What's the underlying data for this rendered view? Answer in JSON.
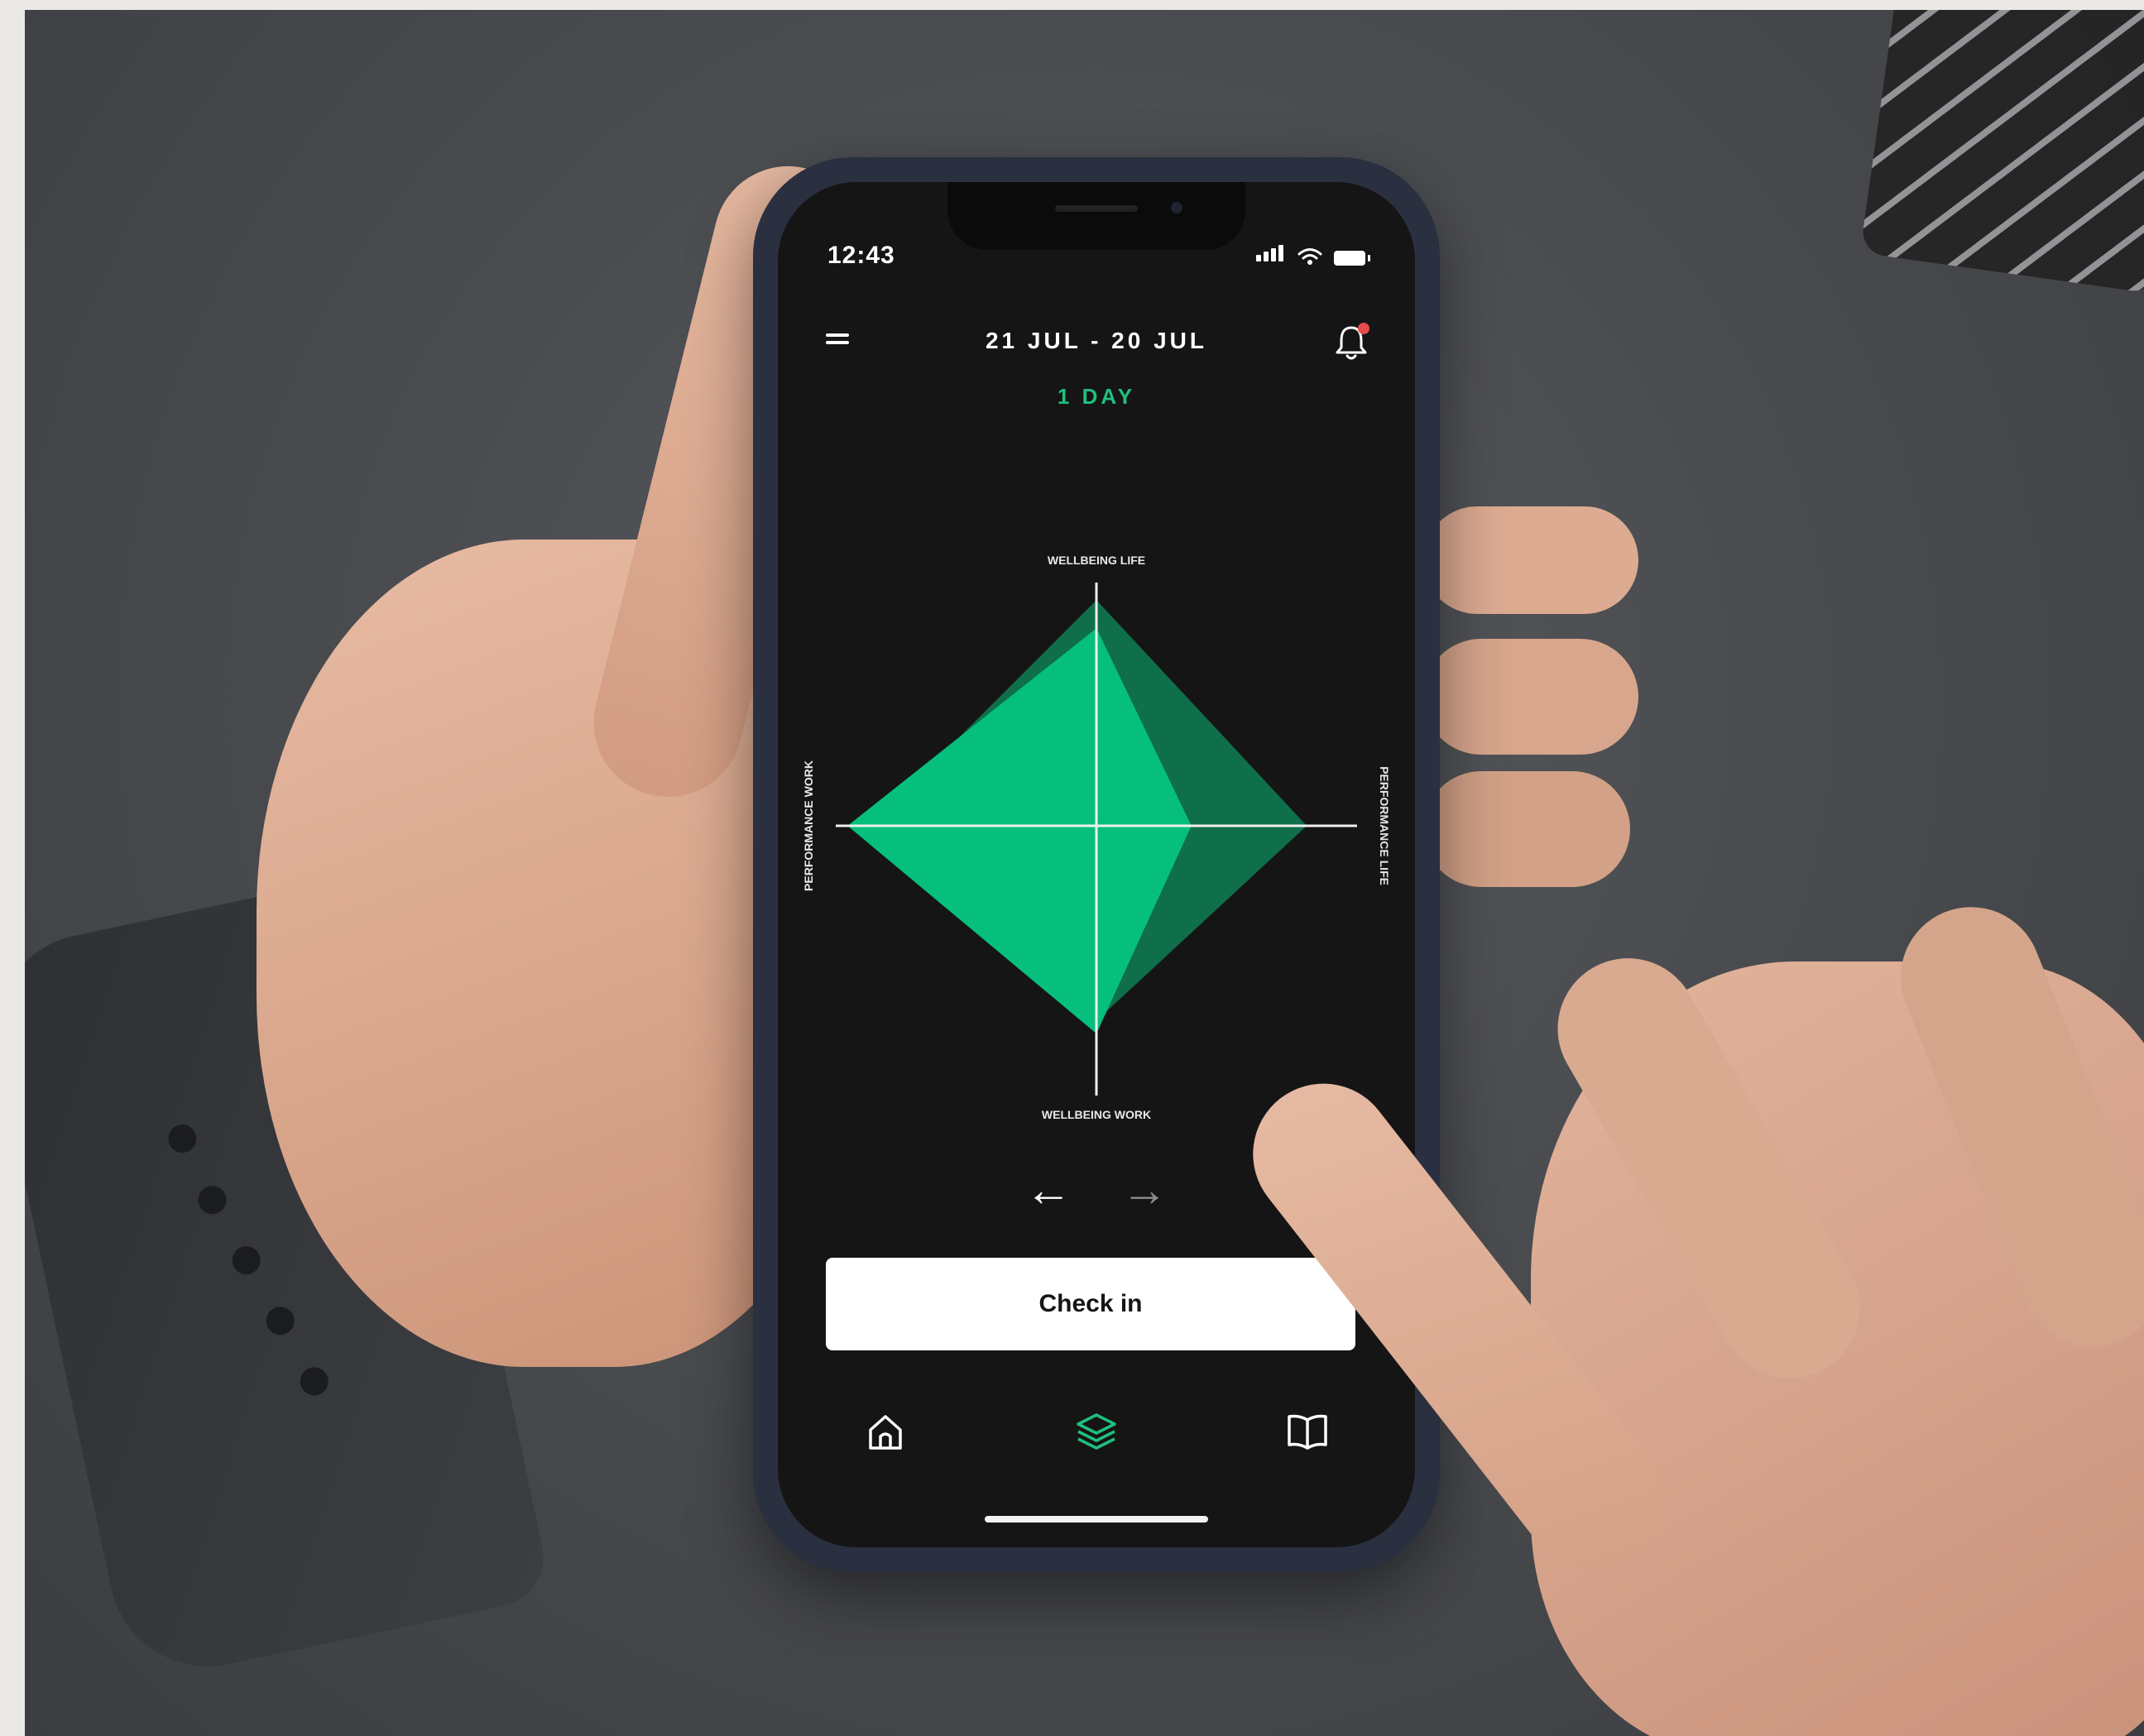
{
  "status_bar": {
    "time": "12:43"
  },
  "header": {
    "date_range": "21 JUL - 20 JUL",
    "period": "1 DAY",
    "accent_color": "#1fc07e",
    "notification_dot_color": "#e64b4b"
  },
  "chart_data": {
    "type": "radar",
    "axes": [
      "WELLBEING LIFE",
      "PERFORMANCE LIFE",
      "WELLBEING WORK",
      "PERFORMANCE WORK"
    ],
    "series": [
      {
        "values": [
          0.88,
          0.82,
          0.76,
          0.88
        ],
        "color": "#0f6f4a"
      },
      {
        "values": [
          0.77,
          0.37,
          0.81,
          0.64
        ],
        "color": "#16ad73"
      },
      {
        "values": [
          0.77,
          0.37,
          0.81,
          0.97
        ],
        "color": "#06bf7d"
      }
    ]
  },
  "navigation": {
    "prev_icon": "arrow-left-icon",
    "next_icon": "arrow-right-icon"
  },
  "actions": {
    "checkin_label": "Check in"
  },
  "tabbar": {
    "items": [
      {
        "icon": "home-icon",
        "active": false
      },
      {
        "icon": "layers-icon",
        "active": true
      },
      {
        "icon": "book-icon",
        "active": false
      }
    ]
  }
}
